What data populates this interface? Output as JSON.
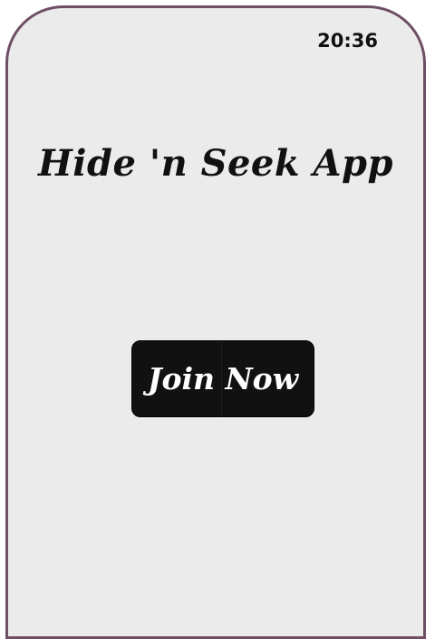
{
  "status_bar": {
    "time": "20:36"
  },
  "main": {
    "title": "Hide 'n Seek App",
    "join_button_label": "Join Now"
  },
  "colors": {
    "frame_border": "#6e4f66",
    "screen_background": "#ebebeb",
    "button_background": "#111111",
    "text_primary": "#111111",
    "button_text": "#ffffff"
  }
}
